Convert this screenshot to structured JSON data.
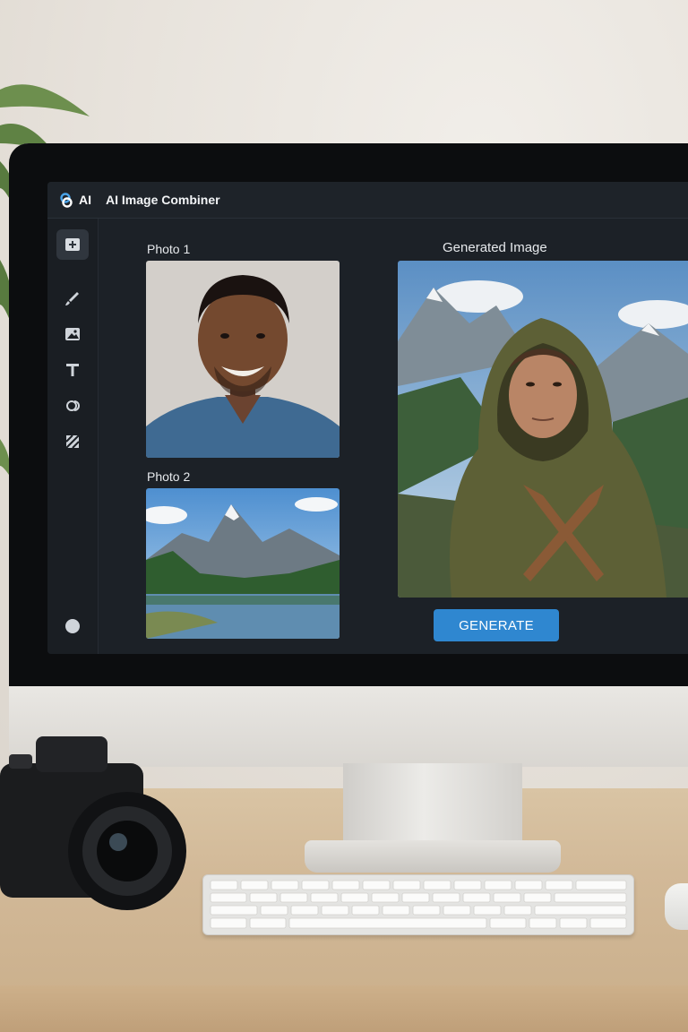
{
  "app": {
    "logo_text": "AI",
    "title": "AI Image Combiner"
  },
  "sidebar": {
    "tools": [
      {
        "icon": "add-image-icon",
        "active": true
      },
      {
        "icon": "brush-icon",
        "active": false
      },
      {
        "icon": "image-edit-icon",
        "active": false
      },
      {
        "icon": "text-icon",
        "active": false
      },
      {
        "icon": "shapes-icon",
        "active": false
      },
      {
        "icon": "pattern-icon",
        "active": false
      }
    ],
    "footer_icon": "avatar-dot-icon"
  },
  "main": {
    "photo1_label": "Photo 1",
    "photo2_label": "Photo 2",
    "generated_label": "Generated Image",
    "generate_button": "GENERATE"
  },
  "colors": {
    "accent": "#2f87d0",
    "screen_bg": "#1c2127",
    "titlebar_bg": "#1e2329"
  }
}
